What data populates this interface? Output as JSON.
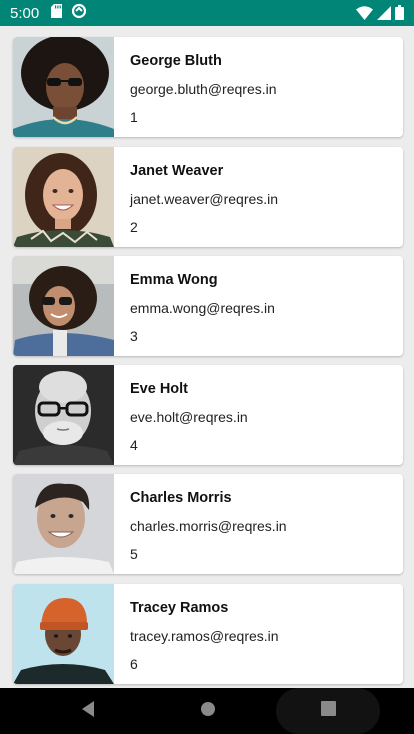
{
  "status_bar": {
    "time": "5:00",
    "left_icons": [
      "sd-card-icon",
      "sync-icon"
    ],
    "right_icons": [
      "wifi-icon",
      "cellular-signal-icon",
      "battery-icon"
    ],
    "color": "#008577"
  },
  "users": [
    {
      "name": "George Bluth",
      "email": "george.bluth@reqres.in",
      "id": "1"
    },
    {
      "name": "Janet Weaver",
      "email": "janet.weaver@reqres.in",
      "id": "2"
    },
    {
      "name": "Emma Wong",
      "email": "emma.wong@reqres.in",
      "id": "3"
    },
    {
      "name": "Eve Holt",
      "email": "eve.holt@reqres.in",
      "id": "4"
    },
    {
      "name": "Charles Morris",
      "email": "charles.morris@reqres.in",
      "id": "5"
    },
    {
      "name": "Tracey Ramos",
      "email": "tracey.ramos@reqres.in",
      "id": "6"
    }
  ],
  "nav_bar": {
    "buttons": [
      "back-icon",
      "home-icon",
      "recents-icon"
    ]
  }
}
